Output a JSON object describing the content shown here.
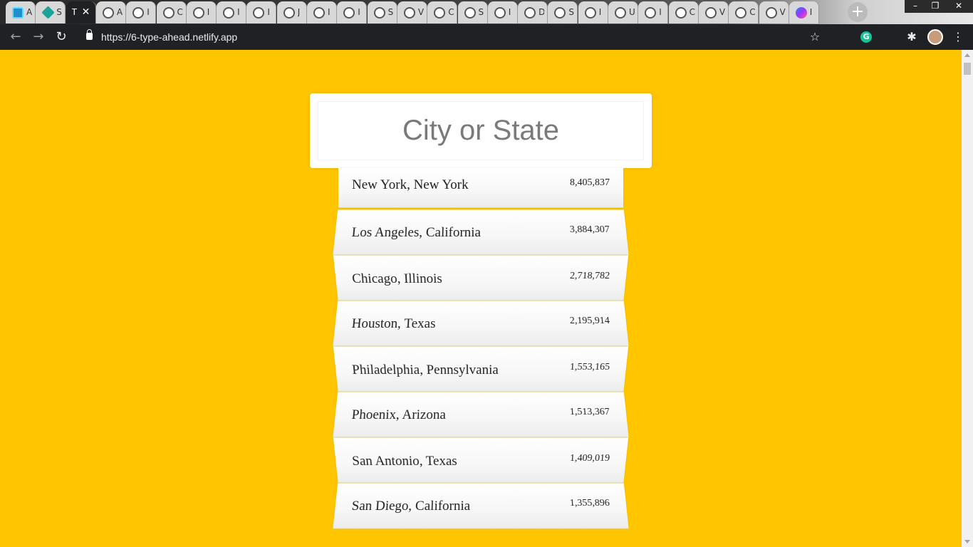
{
  "browser": {
    "tabs": [
      {
        "icon": "react-icon",
        "title": "A"
      },
      {
        "icon": "teal-diamond-icon",
        "title": "S"
      },
      {
        "icon": "none",
        "title": "T",
        "active": true
      },
      {
        "icon": "globe-icon",
        "title": "A"
      },
      {
        "icon": "globe-icon",
        "title": "I"
      },
      {
        "icon": "globe-icon",
        "title": "C"
      },
      {
        "icon": "globe-icon",
        "title": "I"
      },
      {
        "icon": "globe-icon",
        "title": "I"
      },
      {
        "icon": "globe-icon",
        "title": "I"
      },
      {
        "icon": "globe-icon",
        "title": "J"
      },
      {
        "icon": "globe-icon",
        "title": "I"
      },
      {
        "icon": "globe-icon",
        "title": "I"
      },
      {
        "icon": "globe-icon",
        "title": "S"
      },
      {
        "icon": "globe-icon",
        "title": "V"
      },
      {
        "icon": "globe-icon",
        "title": "C"
      },
      {
        "icon": "globe-icon",
        "title": "S"
      },
      {
        "icon": "globe-icon",
        "title": "I"
      },
      {
        "icon": "globe-icon",
        "title": "D"
      },
      {
        "icon": "globe-icon",
        "title": "S"
      },
      {
        "icon": "globe-icon",
        "title": "I"
      },
      {
        "icon": "globe-icon",
        "title": "U"
      },
      {
        "icon": "globe-icon",
        "title": "I"
      },
      {
        "icon": "globe-icon",
        "title": "C"
      },
      {
        "icon": "globe-icon",
        "title": "V"
      },
      {
        "icon": "globe-icon",
        "title": "C"
      },
      {
        "icon": "globe-icon",
        "title": "V"
      },
      {
        "icon": "messenger-icon",
        "title": "I"
      }
    ],
    "close_glyph": "✕",
    "new_tab_glyph": "+",
    "url": "https://6-type-ahead.netlify.app",
    "window_controls": {
      "minimize": "–",
      "restore": "❐",
      "close": "✕"
    },
    "nav": {
      "back": "←",
      "forward": "→",
      "reload": "↻"
    },
    "toolbar_icons": {
      "star": "☆",
      "extensions": "✱",
      "menu": "⋮",
      "grammarly": "G"
    }
  },
  "search": {
    "placeholder": "City or State"
  },
  "suggestions": [
    {
      "name": "New York, New York",
      "population": "8,405,837"
    },
    {
      "name": "Los Angeles, California",
      "population": "3,884,307"
    },
    {
      "name": "Chicago, Illinois",
      "population": "2,718,782"
    },
    {
      "name": "Houston, Texas",
      "population": "2,195,914"
    },
    {
      "name": "Philadelphia, Pennsylvania",
      "population": "1,553,165"
    },
    {
      "name": "Phoenix, Arizona",
      "population": "1,513,367"
    },
    {
      "name": "San Antonio, Texas",
      "population": "1,409,019"
    },
    {
      "name": "San Diego, California",
      "population": "1,355,896"
    }
  ],
  "colors": {
    "page_background": "#ffc600",
    "browser_chrome": "#202124"
  }
}
